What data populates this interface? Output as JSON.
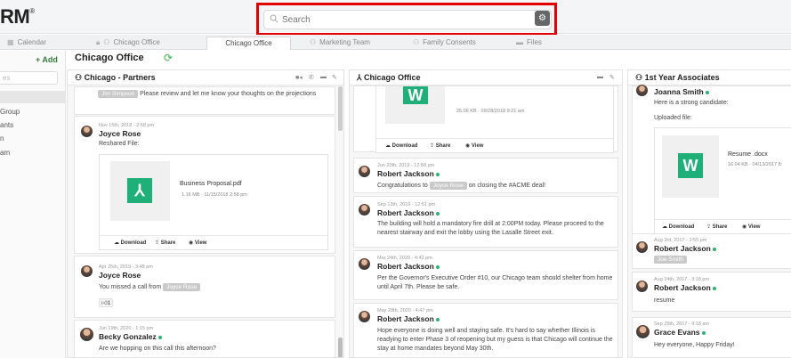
{
  "app": {
    "logo": "RM",
    "logo_mark": "®"
  },
  "search": {
    "placeholder": "Search",
    "icon": "search-icon",
    "settings_icon": "gear-icon"
  },
  "tabs": [
    {
      "label": "Calendar",
      "icon": "calendar-icon"
    },
    {
      "label": "Chicago Office",
      "icon": "users-icon"
    },
    {
      "label": "Chicago Office",
      "icon": "none"
    },
    {
      "label": "Marketing Team",
      "icon": "users-icon"
    },
    {
      "label": "Family Consents",
      "icon": "users-icon"
    },
    {
      "label": "Files",
      "icon": "folder-icon"
    }
  ],
  "sidebar": {
    "add_label": "+ Add",
    "filter_placeholder": "es",
    "items": [
      "Group",
      "ants",
      "n",
      "am"
    ]
  },
  "header": {
    "title": "Chicago Office"
  },
  "columns": [
    {
      "title": "Chicago - Partners",
      "posts": [
        {
          "mention": "Jim Simpson",
          "text": "Please review and let me know your thoughts on the projections"
        },
        {
          "meta": "Nov 15th, 2018 - 2:58 pm",
          "name": "Joyce Rose",
          "text": "Reshared File:",
          "file": {
            "name": "Business Proposal.pdf",
            "info": "1.16 MB · 11/15/2018 2:58 pm"
          },
          "actions": [
            "Download",
            "Share",
            "View"
          ]
        },
        {
          "meta": "Apr 25th, 2019 - 3:48 pm",
          "name": "Joyce Rose",
          "text": "You missed a call from",
          "mention": "Joyce Rose",
          "likes": "1"
        },
        {
          "meta": "Jun 19th, 2020 - 1:15 pm",
          "name": "Becky Gonzalez",
          "text": "Are we hopping on this call this afternoon?"
        }
      ]
    },
    {
      "title": "Chicago Office",
      "posts": [
        {
          "file": {
            "info": "25.06 KB · 09/28/2018 9:21 am"
          },
          "actions": [
            "Download",
            "Share",
            "View"
          ]
        },
        {
          "meta": "Jun 20th, 2019 - 12:58 pm",
          "name": "Robert Jackson",
          "text_before": "Congratulations to",
          "mention": "Joyce Rose",
          "text_after": "on closing the #ACME deal!"
        },
        {
          "meta": "Sep 13th, 2019 - 12:51 pm",
          "name": "Robert Jackson",
          "text": "The building will hold a mandatory fire drill at 2:00PM today. Please proceed to the nearest stairway and exit the lobby using the Lasalle Street exit."
        },
        {
          "meta": "Mar 24th, 2020 - 4:42 pm",
          "name": "Robert Jackson",
          "text": "Per the Governor's Executive Order #10, our Chicago team should shelter from home until April 7th.  Please be safe."
        },
        {
          "meta": "May 28th, 2020 - 4:47 pm",
          "name": "Robert Jackson",
          "text": "Hope everyone is doing well and staying safe. It's hard to say whether Illinois is readying to enter Phase 3 of reopening but my guess is that Chicago will continue the stay at home mandates beyond May 30th."
        }
      ]
    },
    {
      "title": "1st Year Associates",
      "posts": [
        {
          "name": "Joanna Smith",
          "text": "Here is a strong candidate:",
          "text2": "Uploaded file:",
          "file": {
            "name": "Resume .docx",
            "info": "16.04 KB · 04/13/2017 8:"
          },
          "actions": [
            "Download",
            "Share",
            "View"
          ]
        },
        {
          "meta": "Aug 3rd, 2017 - 2:55 pm",
          "name": "Robert Jackson",
          "mention": "Joe Smith"
        },
        {
          "meta": "Aug 24th, 2017 - 3:18 pm",
          "name": "Robert Jackson",
          "text": "resume"
        },
        {
          "meta": "Sep 29th, 2017 - 9:18 am",
          "name": "Grace Evans",
          "text": "Hey everyone, Happy Friday!"
        }
      ]
    }
  ]
}
